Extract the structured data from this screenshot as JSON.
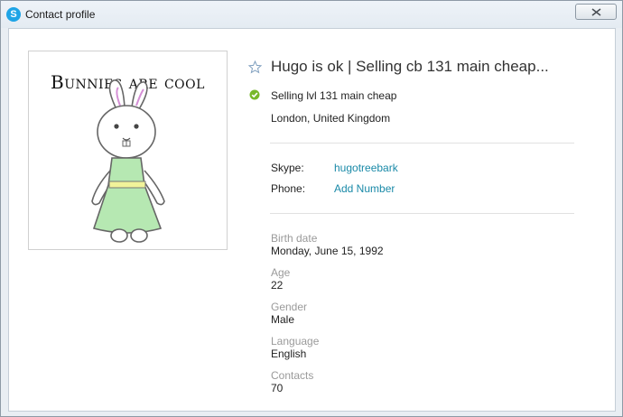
{
  "window": {
    "title": "Contact profile",
    "icon": "skype-icon",
    "accent_color": "#1ea4e6"
  },
  "avatar": {
    "caption": "Bunnies are cool"
  },
  "profile": {
    "display_name": "Hugo is ok | Selling cb 131 main cheap...",
    "mood": "Selling lvl 131 main cheap",
    "status": "online",
    "status_color": "#78b82a",
    "location": "London, United Kingdom"
  },
  "contact": {
    "skype_label": "Skype:",
    "skype_value": "hugotreebark",
    "phone_label": "Phone:",
    "phone_action": "Add Number",
    "link_color": "#1a8aa8"
  },
  "details": {
    "birth_date_label": "Birth date",
    "birth_date": "Monday, June 15, 1992",
    "age_label": "Age",
    "age": "22",
    "gender_label": "Gender",
    "gender": "Male",
    "language_label": "Language",
    "language": "English",
    "contacts_label": "Contacts",
    "contacts": "70"
  }
}
